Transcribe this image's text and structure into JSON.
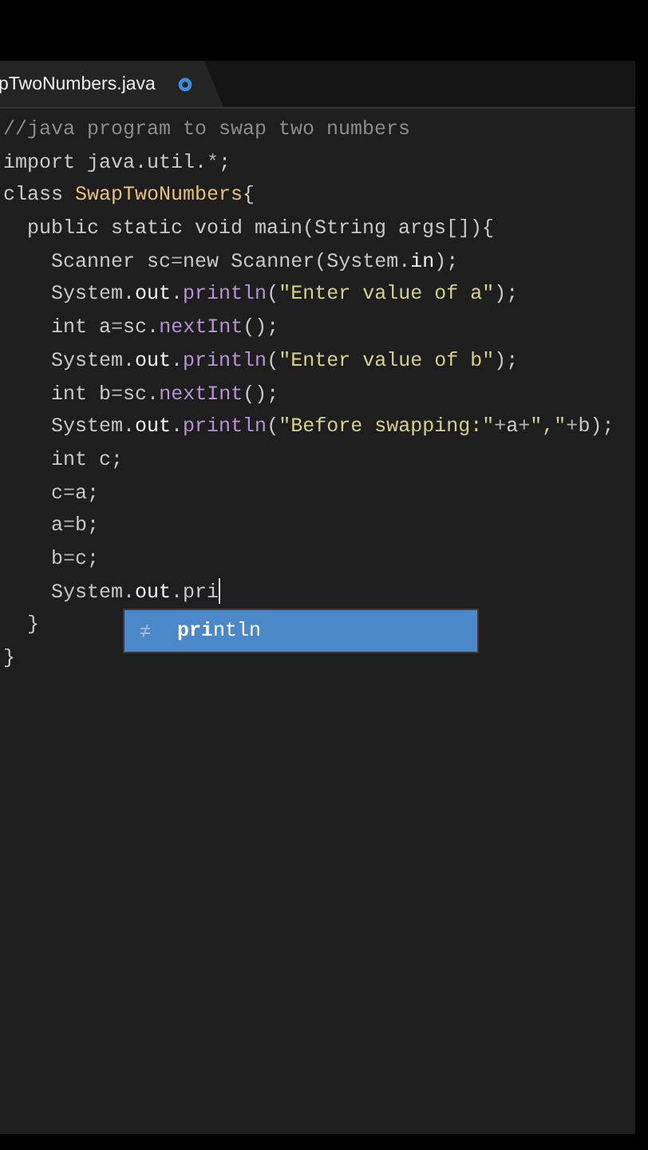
{
  "tab": {
    "title": "pTwoNumbers.java",
    "modified": true,
    "selected": true
  },
  "code_lines": [
    {
      "segments": [
        {
          "kind": "comment",
          "text": "//java program to swap two numbers"
        }
      ]
    },
    {
      "segments": [
        {
          "kind": "keyword",
          "text": "import"
        },
        {
          "kind": "plain",
          "text": " java.util."
        },
        {
          "kind": "operator",
          "text": "*"
        },
        {
          "kind": "plain",
          "text": ";"
        }
      ]
    },
    {
      "segments": [
        {
          "kind": "keyword",
          "text": "class "
        },
        {
          "kind": "classname",
          "text": "SwapTwoNumbers"
        },
        {
          "kind": "plain",
          "text": "{"
        }
      ]
    },
    {
      "segments": [
        {
          "kind": "keyword",
          "text": "  public static void"
        },
        {
          "kind": "plain",
          "text": " main(String args[]){"
        }
      ]
    },
    {
      "segments": [
        {
          "kind": "keyword",
          "text": "    Scanner"
        },
        {
          "kind": "plain",
          "text": " sc"
        },
        {
          "kind": "operator",
          "text": "="
        },
        {
          "kind": "keyword",
          "text": "new"
        },
        {
          "kind": "plain",
          "text": " Scanner(System."
        },
        {
          "kind": "field",
          "text": "in"
        },
        {
          "kind": "plain",
          "text": ");"
        }
      ]
    },
    {
      "segments": [
        {
          "kind": "plain",
          "text": "    System."
        },
        {
          "kind": "field",
          "text": "out"
        },
        {
          "kind": "plain",
          "text": "."
        },
        {
          "kind": "method",
          "text": "println"
        },
        {
          "kind": "plain",
          "text": "("
        },
        {
          "kind": "string",
          "text": "\"Enter value of a\""
        },
        {
          "kind": "plain",
          "text": ");"
        }
      ]
    },
    {
      "segments": [
        {
          "kind": "keyword",
          "text": "    int"
        },
        {
          "kind": "plain",
          "text": " a"
        },
        {
          "kind": "operator",
          "text": "="
        },
        {
          "kind": "plain",
          "text": "sc."
        },
        {
          "kind": "method",
          "text": "nextInt"
        },
        {
          "kind": "plain",
          "text": "();"
        }
      ]
    },
    {
      "segments": [
        {
          "kind": "plain",
          "text": "    System."
        },
        {
          "kind": "field",
          "text": "out"
        },
        {
          "kind": "plain",
          "text": "."
        },
        {
          "kind": "method",
          "text": "println"
        },
        {
          "kind": "plain",
          "text": "("
        },
        {
          "kind": "string",
          "text": "\"Enter value of b\""
        },
        {
          "kind": "plain",
          "text": ");"
        }
      ]
    },
    {
      "segments": [
        {
          "kind": "keyword",
          "text": "    int"
        },
        {
          "kind": "plain",
          "text": " b"
        },
        {
          "kind": "operator",
          "text": "="
        },
        {
          "kind": "plain",
          "text": "sc."
        },
        {
          "kind": "method",
          "text": "nextInt"
        },
        {
          "kind": "plain",
          "text": "();"
        }
      ]
    },
    {
      "segments": [
        {
          "kind": "plain",
          "text": "    System."
        },
        {
          "kind": "field",
          "text": "out"
        },
        {
          "kind": "plain",
          "text": "."
        },
        {
          "kind": "method",
          "text": "println"
        },
        {
          "kind": "plain",
          "text": "("
        },
        {
          "kind": "string",
          "text": "\"Before swapping:\""
        },
        {
          "kind": "operator",
          "text": "+"
        },
        {
          "kind": "plain",
          "text": "a"
        },
        {
          "kind": "operator",
          "text": "+"
        },
        {
          "kind": "string",
          "text": "\",\""
        },
        {
          "kind": "operator",
          "text": "+"
        },
        {
          "kind": "plain",
          "text": "b);"
        }
      ]
    },
    {
      "segments": [
        {
          "kind": "keyword",
          "text": "    int"
        },
        {
          "kind": "plain",
          "text": " c;"
        }
      ]
    },
    {
      "segments": [
        {
          "kind": "plain",
          "text": "    c"
        },
        {
          "kind": "operator",
          "text": "="
        },
        {
          "kind": "plain",
          "text": "a;"
        }
      ]
    },
    {
      "segments": [
        {
          "kind": "plain",
          "text": "    a"
        },
        {
          "kind": "operator",
          "text": "="
        },
        {
          "kind": "plain",
          "text": "b;"
        }
      ]
    },
    {
      "segments": [
        {
          "kind": "plain",
          "text": "    b"
        },
        {
          "kind": "operator",
          "text": "="
        },
        {
          "kind": "plain",
          "text": "c;"
        }
      ]
    },
    {
      "segments": [
        {
          "kind": "plain",
          "text": "    System."
        },
        {
          "kind": "field",
          "text": "out"
        },
        {
          "kind": "plain",
          "text": ".pri"
        },
        {
          "kind": "caret"
        }
      ]
    },
    {
      "segments": [
        {
          "kind": "plain",
          "text": "  }"
        }
      ]
    },
    {
      "segments": [
        {
          "kind": "plain",
          "text": "}"
        }
      ]
    }
  ],
  "autocomplete": {
    "items": [
      {
        "label": "**pri**ntln",
        "selected": true
      }
    ]
  }
}
